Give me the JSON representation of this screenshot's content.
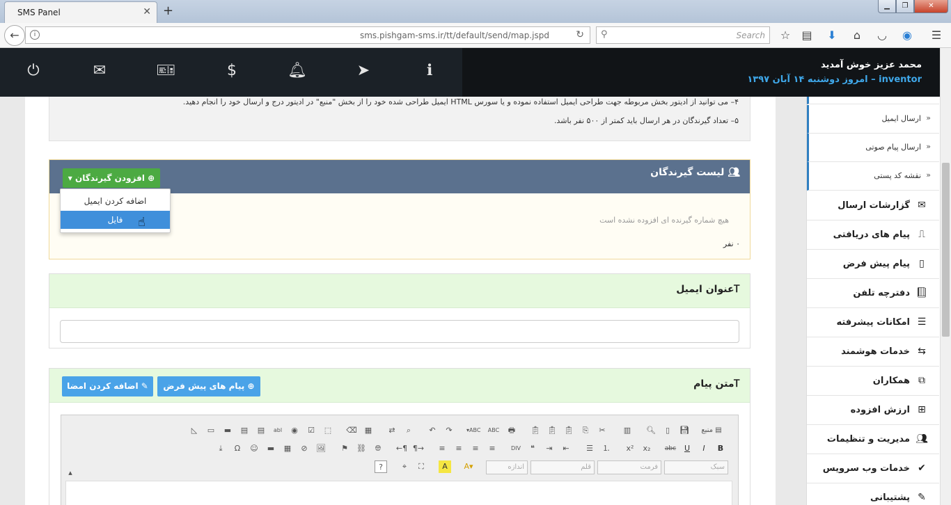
{
  "browser": {
    "tab_title": "SMS Panel",
    "url": "sms.pishgam-sms.ir/tt/default/send/map.jspd",
    "search_placeholder": "Search"
  },
  "header": {
    "welcome": "محمد عزیز خوش آمدید",
    "username": "inventor",
    "date_text": "امروز دوشنبه ۱۴ آبان ۱۳۹۷",
    "separator": " – "
  },
  "notes": {
    "line4": "۴– می توانید از ادیتور بخش مربوطه جهت طراحی ایمیل استفاده نموده و یا سورس HTML ایمیل طراحی شده خود را از بخش \"منبع\" در ادیتور درج و ارسال خود را انجام دهید.",
    "line5": "۵– تعداد گیرندگان در هر ارسال باید کمتر از ۵۰۰ نفر باشد."
  },
  "recipients": {
    "title": "لیست گیرندگان",
    "add_button": "افزودن گیرندگان",
    "empty_message": "هیچ شماره گیرنده ای افزوده نشده است",
    "count": "۰ نفر",
    "dropdown": [
      "اضافه کردن ایمیل",
      "فایل"
    ]
  },
  "subject": {
    "title": "عنوان ایمیل",
    "value": ""
  },
  "message": {
    "title": "متن پیام",
    "preset_button": "پیام های پیش فرض",
    "sign_button": "اضافه کردن امضا",
    "combo_style": "سبک",
    "combo_format": "فرمت",
    "combo_font": "قلم",
    "combo_size": "اندازه",
    "source_label": "منبع"
  },
  "sidebar": {
    "subitems": [
      "ارسال ایمیل",
      "ارسال پیام صوتی",
      "نقشه کد پستی"
    ],
    "items": [
      {
        "label": "گزارشات ارسال",
        "icon": "envelope-icon"
      },
      {
        "label": "پیام های دریافتی",
        "icon": "inbox-icon"
      },
      {
        "label": "پیام پیش فرض",
        "icon": "tablet-icon"
      },
      {
        "label": "دفترچه تلفن",
        "icon": "book-icon"
      },
      {
        "label": "امکانات پیشرفته",
        "icon": "list-icon"
      },
      {
        "label": "خدمات هوشمند",
        "icon": "retweet-icon"
      },
      {
        "label": "همکاران",
        "icon": "sitemap-icon"
      },
      {
        "label": "ارزش افزوده",
        "icon": "plus-square-icon"
      },
      {
        "label": "مدیریت و تنظیمات",
        "icon": "users-icon"
      },
      {
        "label": "خدمات وب سرویس",
        "icon": "check-circle-icon"
      },
      {
        "label": "پشتیبانی",
        "icon": "ticket-icon"
      }
    ]
  }
}
